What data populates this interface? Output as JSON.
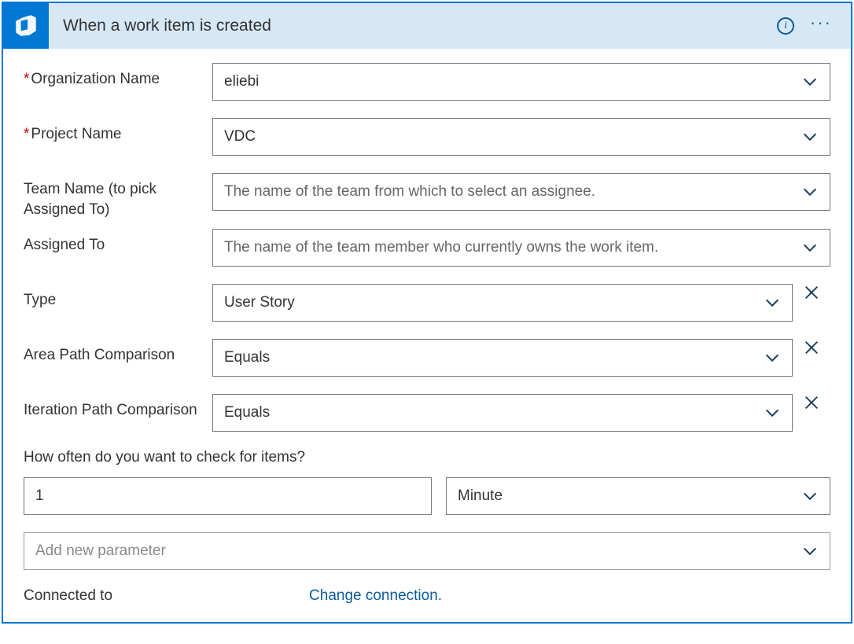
{
  "header": {
    "title": "When a work item is created"
  },
  "fields": {
    "org": {
      "label": "Organization Name",
      "required": true,
      "value": "eliebi"
    },
    "project": {
      "label": "Project Name",
      "required": true,
      "value": "VDC"
    },
    "team": {
      "label": "Team Name (to pick Assigned To)",
      "required": false,
      "placeholder": "The name of the team from which to select an assignee."
    },
    "assigned": {
      "label": "Assigned To",
      "required": false,
      "placeholder": "The name of the team member who currently owns the work item."
    },
    "type": {
      "label": "Type",
      "required": false,
      "value": "User Story",
      "clearable": true
    },
    "area": {
      "label": "Area Path Comparison",
      "required": false,
      "value": "Equals",
      "clearable": true
    },
    "iteration": {
      "label": "Iteration Path Comparison",
      "required": false,
      "value": "Equals",
      "clearable": true
    }
  },
  "poll": {
    "label": "How often do you want to check for items?",
    "value": "1",
    "unit": "Minute"
  },
  "addParam": {
    "placeholder": "Add new parameter"
  },
  "footer": {
    "connected": "Connected to",
    "change": "Change connection."
  }
}
